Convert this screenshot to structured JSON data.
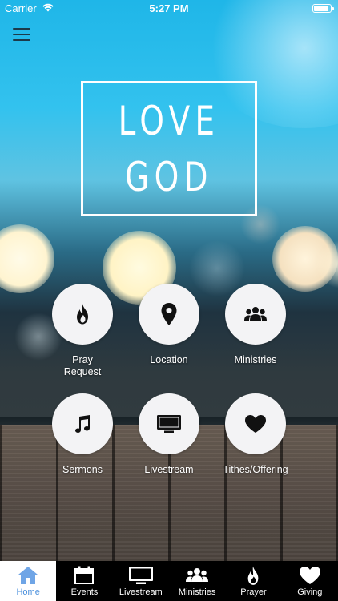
{
  "status_bar": {
    "carrier": "Carrier",
    "time": "5:27 PM"
  },
  "hero": {
    "line1": "LOVE",
    "line2": "GOD"
  },
  "tiles": [
    {
      "label_line1": "Pray",
      "label_line2": "Request",
      "icon": "flame-icon"
    },
    {
      "label_line1": "Location",
      "label_line2": "",
      "icon": "map-pin-icon"
    },
    {
      "label_line1": "Ministries",
      "label_line2": "",
      "icon": "group-icon"
    },
    {
      "label_line1": "Sermons",
      "label_line2": "",
      "icon": "music-note-icon"
    },
    {
      "label_line1": "Livestream",
      "label_line2": "",
      "icon": "tv-icon"
    },
    {
      "label_line1": "Tithes/Offering",
      "label_line2": "",
      "icon": "heart-icon"
    }
  ],
  "tabs": [
    {
      "label": "Home",
      "icon": "home-icon",
      "active": true
    },
    {
      "label": "Events",
      "icon": "calendar-icon",
      "active": false
    },
    {
      "label": "Livestream",
      "icon": "tv-icon",
      "active": false
    },
    {
      "label": "Ministries",
      "icon": "group-icon",
      "active": false
    },
    {
      "label": "Prayer",
      "icon": "flame-icon",
      "active": false
    },
    {
      "label": "Giving",
      "icon": "heart-icon",
      "active": false
    }
  ],
  "colors": {
    "active_tab_text": "#4a8fdc",
    "tile_bg": "#f3f3f5",
    "tabbar_bg": "#000000"
  }
}
